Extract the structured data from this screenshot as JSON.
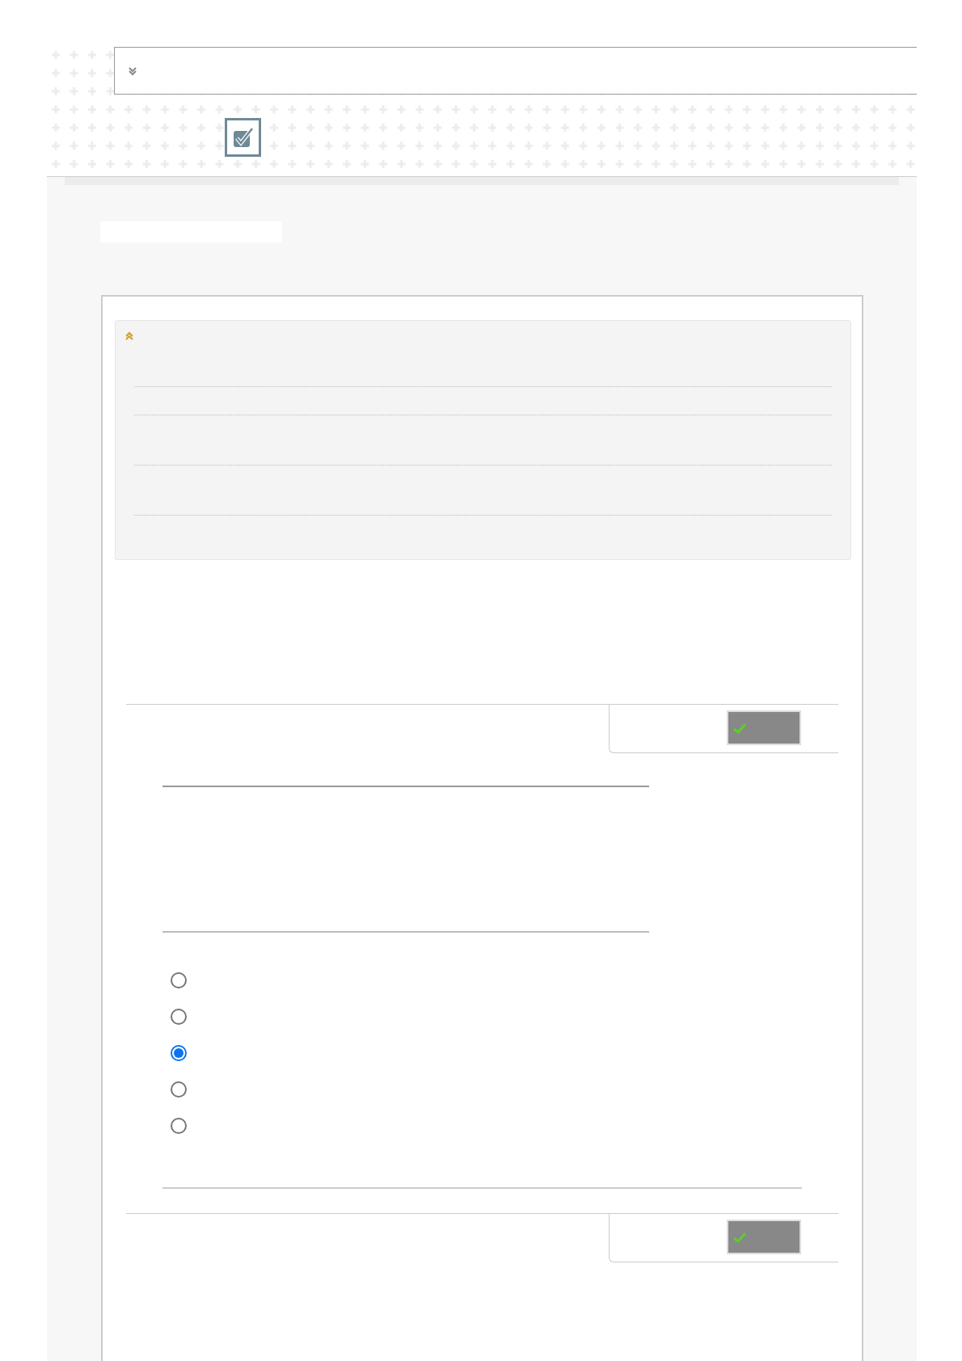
{
  "header": {
    "expanded": false
  },
  "summary": {
    "expanded": true,
    "rows": [
      {
        "kind": "rule"
      },
      {
        "kind": "rule"
      },
      {
        "kind": "rule"
      },
      {
        "kind": "rule"
      }
    ]
  },
  "options": [
    {
      "selected": false
    },
    {
      "selected": false
    },
    {
      "selected": true
    },
    {
      "selected": false
    },
    {
      "selected": false
    }
  ],
  "check_buttons": [
    {
      "kind": "check"
    },
    {
      "kind": "check"
    }
  ]
}
